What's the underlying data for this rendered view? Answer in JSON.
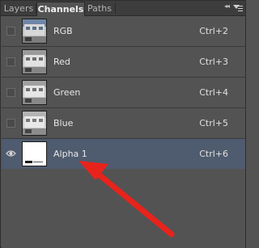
{
  "tabs": [
    {
      "label": "Layers",
      "active": false
    },
    {
      "label": "Channels",
      "active": true
    },
    {
      "label": "Paths",
      "active": false
    }
  ],
  "collapse_glyph": "◂◂",
  "channels": [
    {
      "name": "RGB",
      "shortcut": "Ctrl+2",
      "visible": false,
      "selected": false,
      "thumb": "rgb"
    },
    {
      "name": "Red",
      "shortcut": "Ctrl+3",
      "visible": false,
      "selected": false,
      "thumb": "gray"
    },
    {
      "name": "Green",
      "shortcut": "Ctrl+4",
      "visible": false,
      "selected": false,
      "thumb": "gray"
    },
    {
      "name": "Blue",
      "shortcut": "Ctrl+5",
      "visible": false,
      "selected": false,
      "thumb": "gray"
    },
    {
      "name": "Alpha 1",
      "shortcut": "Ctrl+6",
      "visible": true,
      "selected": true,
      "thumb": "alpha"
    }
  ],
  "colors": {
    "panel_bg": "#535353",
    "selected_row": "#4f5b6e",
    "arrow": "#e8231c"
  },
  "icons": {
    "visibility_on": "eye-icon",
    "visibility_off": "empty-visibility-box",
    "menu": "panel-menu-icon",
    "collapse": "collapse-double-arrow-icon"
  }
}
